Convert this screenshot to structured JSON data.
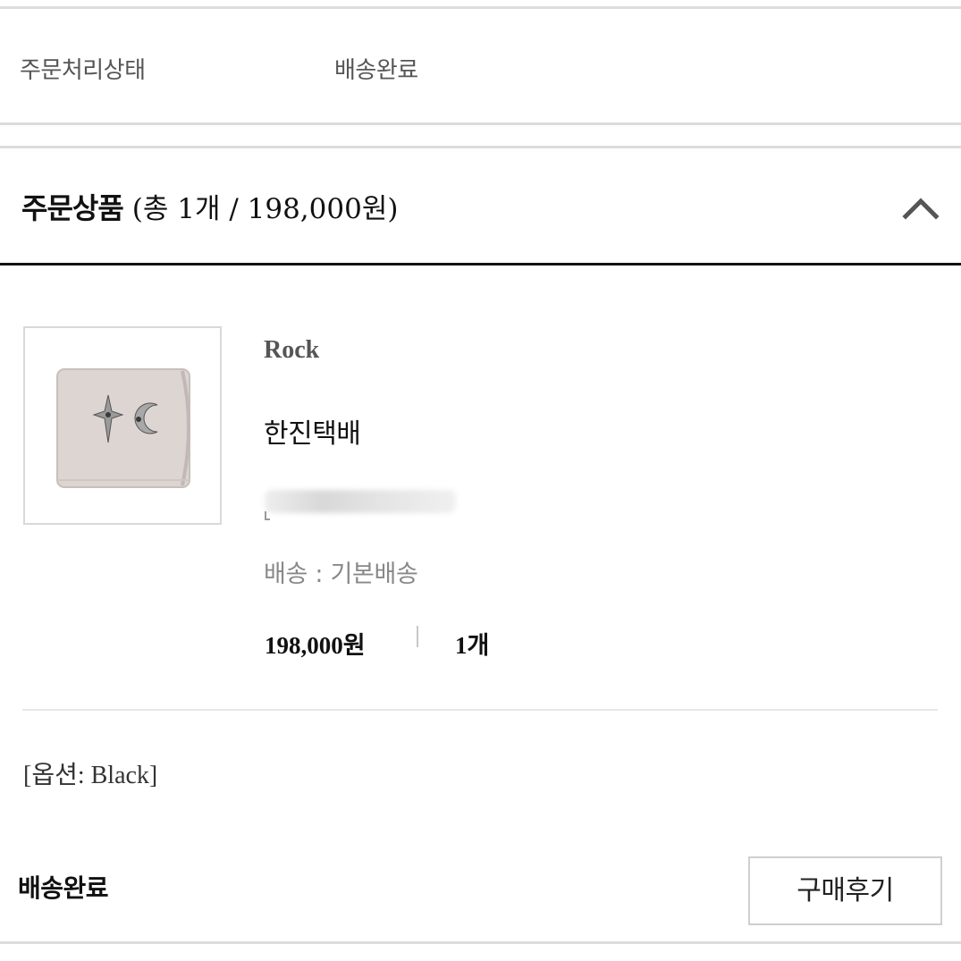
{
  "order_status": {
    "label": "주문처리상태",
    "value": "배송완료"
  },
  "products_section": {
    "title": "주문상품",
    "summary": "(총 1개 / 198,000원)",
    "toggle_icon": "chevron-up-icon"
  },
  "product": {
    "brand": "Rock",
    "name": "한진택배",
    "shipping": "배송 : 기본배송",
    "price": "198,000원",
    "quantity": "1개",
    "option": "[옵션: Black]",
    "image": "wallet-thumbnail"
  },
  "footer": {
    "delivery_status": "배송완료",
    "review_button_label": "구매후기"
  }
}
